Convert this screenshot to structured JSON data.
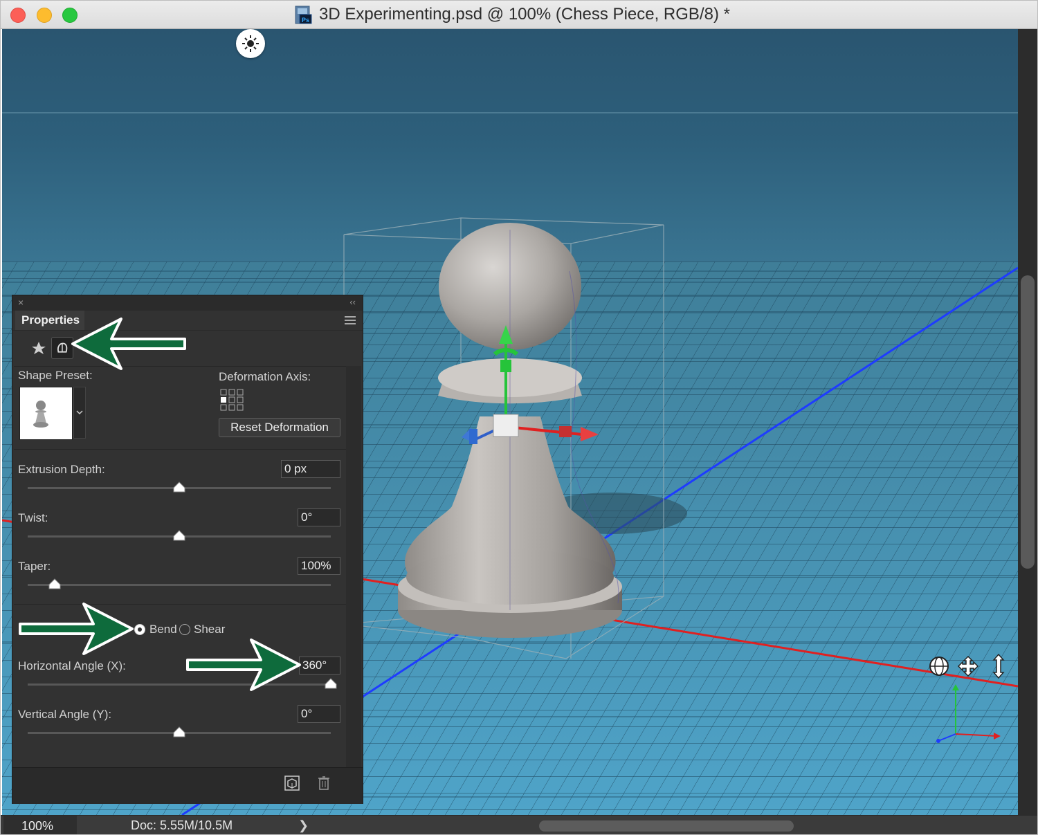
{
  "window": {
    "title": "3D Experimenting.psd @ 100% (Chess Piece, RGB/8) *",
    "doc_icon": "ps-document-icon"
  },
  "canvas": {
    "light_icon": "sun-light-icon",
    "nav_icons": [
      "orbit-icon",
      "pan-icon",
      "dolly-icon"
    ]
  },
  "properties": {
    "close_glyph": "×",
    "collapse_glyph": "‹‹",
    "tab_label": "Properties",
    "mode_icons": [
      "mesh-icon",
      "deform-icon"
    ],
    "shape_preset_label": "Shape Preset:",
    "deformation_axis_label": "Deformation Axis:",
    "reset_button": "Reset Deformation",
    "extrusion_depth": {
      "label": "Extrusion Depth:",
      "value": "0 px",
      "slider": 0.5
    },
    "twist": {
      "label": "Twist:",
      "value": "0°",
      "slider": 0.5
    },
    "taper": {
      "label": "Taper:",
      "value": "100%",
      "slider": 0.09
    },
    "mode": {
      "bend_label": "Bend",
      "shear_label": "Shear",
      "selected": "Bend"
    },
    "horizontal_angle": {
      "label": "Horizontal Angle (X):",
      "value": "360°",
      "slider": 1.0
    },
    "vertical_angle": {
      "label": "Vertical Angle (Y):",
      "value": "0°",
      "slider": 0.5
    },
    "bottom_icons": [
      "render-icon",
      "trash-icon"
    ]
  },
  "status": {
    "zoom": "100%",
    "doc": "Doc: 5.55M/10.5M",
    "arrow": "❯"
  },
  "colors": {
    "annotation_arrow": "#0e6b3c",
    "x_axis": "#e02020",
    "y_axis": "#25c43a",
    "z_axis": "#1e3cff"
  }
}
